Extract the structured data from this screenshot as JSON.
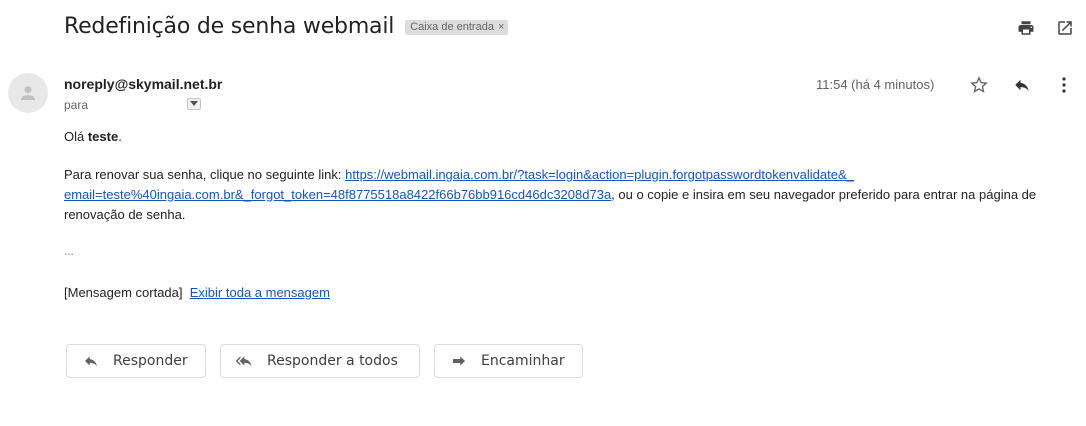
{
  "subject": "Redefinição de senha webmail",
  "label": {
    "text": "Caixa de entrada",
    "remove": "×"
  },
  "message": {
    "from": "noreply@skymail.net.br",
    "to_label": "para",
    "time": "11:54 (há 4 minutos)",
    "greeting_prefix": "Olá ",
    "greeting_name": "teste",
    "greeting_suffix": ".",
    "p1_before": "Para renovar sua senha, clique no seguinte link: ",
    "link": "https://webmail.ingaia.com.br/?task=login&action=plugin.forgotpasswordtokenvalidate&_ email=teste%40ingaia.com.br&_forgot_token=48f8775518a8422f66b76bb916cd46dc3208d73a",
    "p1_after": ", ou o copie e insira em seu navegador preferido para entrar na página de renovação de senha.",
    "ellipsis": "...",
    "clipped_label": "[Mensagem cortada]",
    "clipped_link": "Exibir toda a mensagem"
  },
  "actions": {
    "reply": "Responder",
    "reply_all": "Responder a todos",
    "forward": "Encaminhar"
  },
  "icons": [
    "print-icon",
    "open-new-window-icon",
    "avatar-person-icon",
    "dropdown-arrow-icon",
    "star-icon",
    "reply-icon",
    "more-vert-icon",
    "reply-all-icon",
    "forward-icon"
  ]
}
